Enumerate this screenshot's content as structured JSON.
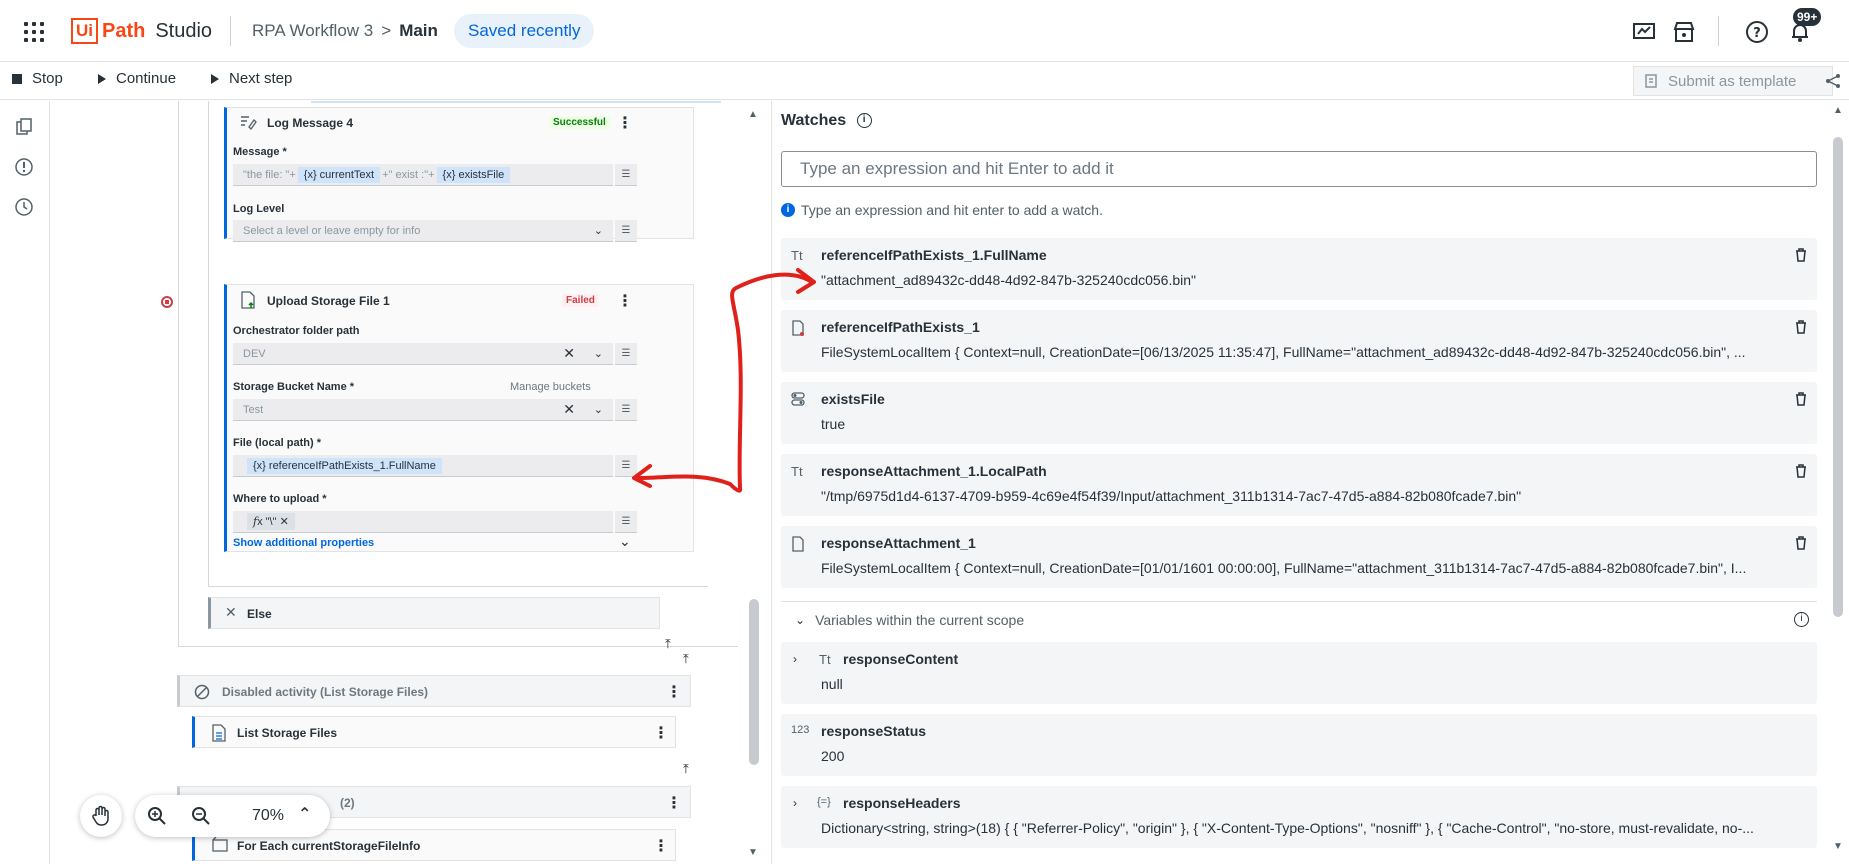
{
  "app": {
    "logo_ui": "Ui",
    "logo_path": "Path",
    "logo_studio": "Studio",
    "workflow": "RPA Workflow 3",
    "breadcrumb_sep": ">",
    "current": "Main",
    "saved": "Saved recently",
    "notification_badge": "99+"
  },
  "toolbar": {
    "stop": "Stop",
    "continue": "Continue",
    "next_step": "Next step",
    "submit_template": "Submit as template"
  },
  "canvas": {
    "log_message": {
      "title": "Log Message 4",
      "status": "Successful",
      "message_label": "Message *",
      "message_parts": [
        "\"the file: \"+",
        "{x} currentText",
        "+\" exist :\"+",
        "{x} existsFile"
      ],
      "log_level_label": "Log Level",
      "log_level_placeholder": "Select a level or leave empty for info"
    },
    "upload": {
      "title": "Upload Storage File 1",
      "status": "Failed",
      "folder_label": "Orchestrator folder path",
      "folder_value": "DEV",
      "bucket_label": "Storage Bucket Name *",
      "manage_buckets": "Manage buckets",
      "bucket_value": "Test",
      "file_label": "File (local path) *",
      "file_value": "{x} referenceIfPathExists_1.FullName",
      "where_label": "Where to upload *",
      "where_value": "\"\\\"",
      "show_more": "Show additional properties"
    },
    "else_label": "Else",
    "disabled_activity": "Disabled activity (List Storage Files)",
    "list_storage": "List Storage Files",
    "hidden_row": "(2)",
    "for_each": "For Each currentStorageFileInfo",
    "zoom": "70%"
  },
  "watches": {
    "title": "Watches",
    "input_placeholder": "Type an expression and hit Enter to add it",
    "hint": "Type an expression and hit enter to add a watch.",
    "items": [
      {
        "icon": "Tt",
        "name": "referenceIfPathExists_1.FullName",
        "value": "\"attachment_ad89432c-dd48-4d92-847b-325240cdc056.bin\""
      },
      {
        "icon": "file",
        "name": "referenceIfPathExists_1",
        "value": "FileSystemLocalItem { Context=null, CreationDate=[06/13/2025 11:35:47], FullName=\"attachment_ad89432c-dd48-4d92-847b-325240cdc056.bin\", ..."
      },
      {
        "icon": "toggle",
        "name": "existsFile",
        "value": "true"
      },
      {
        "icon": "Tt",
        "name": "responseAttachment_1.LocalPath",
        "value": "\"/tmp/6975d1d4-6137-4709-b959-4c69e4f54f39/Input/attachment_311b1314-7ac7-47d5-a884-82b080fcade7.bin\""
      },
      {
        "icon": "file",
        "name": "responseAttachment_1",
        "value": "FileSystemLocalItem { Context=null, CreationDate=[01/01/1601 00:00:00], FullName=\"attachment_311b1314-7ac7-47d5-a884-82b080fcade7.bin\", I..."
      }
    ],
    "scope_title": "Variables within the current scope",
    "scope_items": [
      {
        "icon": "Tt",
        "name": "responseContent",
        "value": "null"
      },
      {
        "icon": "123",
        "name": "responseStatus",
        "value": "200"
      },
      {
        "icon": "{=}",
        "name": "responseHeaders",
        "value": "Dictionary<string, string>(18) { { \"Referrer-Policy\", \"origin\" }, { \"X-Content-Type-Options\", \"nosniff\" }, { \"Cache-Control\", \"no-store, must-revalidate, no-..."
      }
    ]
  },
  "colors": {
    "brand": "#fa4616",
    "accent": "#0067df",
    "annotation": "#e0201b"
  }
}
